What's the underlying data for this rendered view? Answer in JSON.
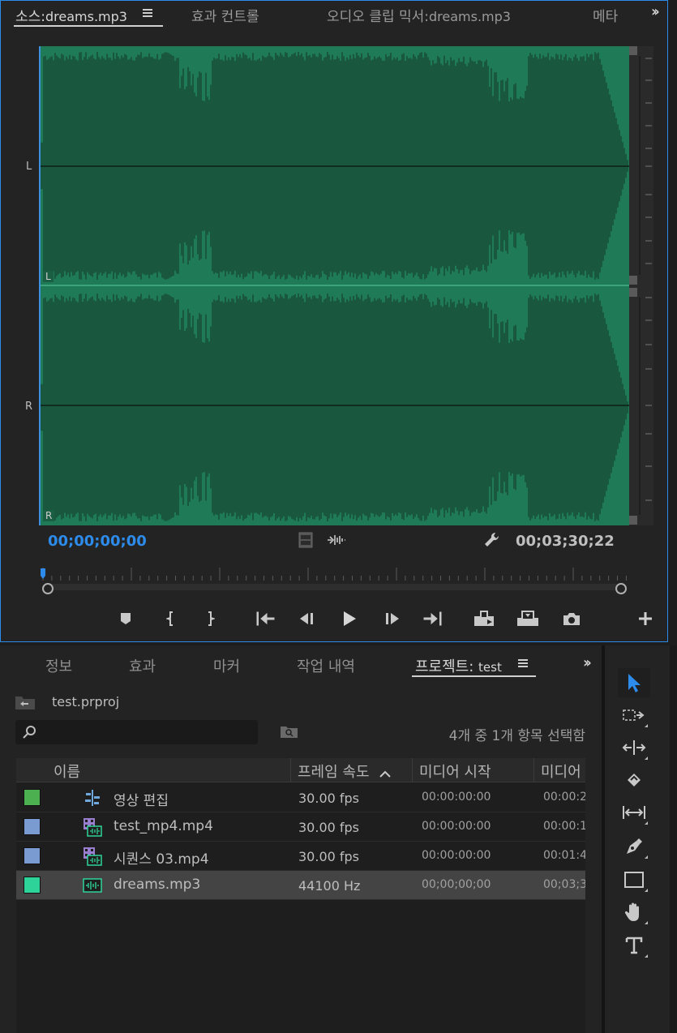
{
  "source_panel": {
    "tabs": [
      {
        "prefix": "소스:",
        "name": "dreams.mp3",
        "active": true
      },
      {
        "label": "효과 컨트롤",
        "active": false
      },
      {
        "prefix": "오디오 클립 믹서:",
        "name": "dreams.mp3",
        "active": false
      },
      {
        "label": "메타",
        "active": false
      }
    ],
    "channels": {
      "left": "L",
      "right": "R"
    },
    "timecode_current": "00;00;00;00",
    "timecode_duration": "00;03;30;22",
    "colors": {
      "accent": "#2d8ceb",
      "waveform_bg": "#1f7a57",
      "waveform_fg": "#16402e"
    },
    "icons": [
      "film-strip-icon",
      "audio-waveform-icon",
      "wrench-icon"
    ],
    "controls": [
      "add-marker-icon",
      "mark-in-icon",
      "mark-out-icon",
      "go-to-in-icon",
      "step-back-icon",
      "play-icon",
      "step-forward-icon",
      "go-to-out-icon",
      "insert-icon",
      "overwrite-icon",
      "export-frame-icon",
      "add-button-icon"
    ]
  },
  "project_panel": {
    "tabs": [
      {
        "label": "정보"
      },
      {
        "label": "효과"
      },
      {
        "label": "마커"
      },
      {
        "label": "작업 내역"
      },
      {
        "prefix": "프로젝트:",
        "name": "test",
        "active": true
      }
    ],
    "project_file": "test.prproj",
    "search": {
      "placeholder": ""
    },
    "selected_count": "4개 중 1개 항목 선택함",
    "columns": {
      "name": "이름",
      "frame_rate": "프레임 속도",
      "media_start": "미디어 시작",
      "media_end": "미디어"
    },
    "items": [
      {
        "name": "영상 편집",
        "frame_rate": "30.00 fps",
        "media_start": "00:00:00:00",
        "media_end": "00:00:2",
        "swatch": "#4cb050",
        "icon": "sequence-icon"
      },
      {
        "name": "test_mp4.mp4",
        "frame_rate": "30.00 fps",
        "media_start": "00:00:00:00",
        "media_end": "00:00:1",
        "swatch": "#7a9bd1",
        "icon": "video-clip-icon"
      },
      {
        "name": "시퀀스 03.mp4",
        "frame_rate": "30.00 fps",
        "media_start": "00:00:00:00",
        "media_end": "00:01:4",
        "swatch": "#7a9bd1",
        "icon": "video-clip-icon"
      },
      {
        "name": "dreams.mp3",
        "frame_rate": "44100 Hz",
        "media_start": "00;00;00;00",
        "media_end": "00;03;3",
        "swatch": "#2ed39a",
        "icon": "audio-clip-icon",
        "selected": true
      }
    ]
  },
  "tools": [
    "selection-tool-icon",
    "track-select-tool-icon",
    "ripple-edit-tool-icon",
    "razor-tool-icon",
    "slip-tool-icon",
    "pen-tool-icon",
    "rectangle-tool-icon",
    "hand-tool-icon",
    "type-tool-icon"
  ]
}
